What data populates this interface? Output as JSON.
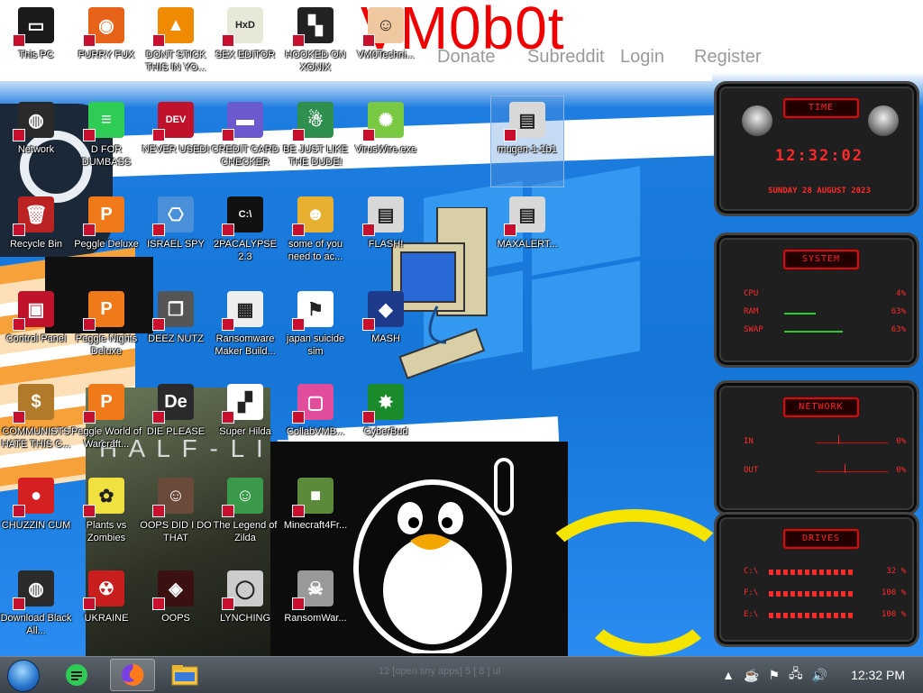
{
  "wallpaper": {
    "brand": "VM0b0t",
    "nav": [
      "Donate",
      "Subreddit",
      "Login",
      "Register"
    ]
  },
  "desktop_icons": [
    {
      "id": "this-pc",
      "label": "This PC",
      "icon": "computer-icon",
      "color": "#1a1a1a",
      "glyph": "▭"
    },
    {
      "id": "furry-fux",
      "label": "FURRY FUX",
      "icon": "firefox-icon",
      "color": "#e8631a",
      "glyph": "◉"
    },
    {
      "id": "dont-stick",
      "label": "DONT STICK THIS IN YO...",
      "icon": "vlc-cone-icon",
      "color": "#f08a00",
      "glyph": "▲"
    },
    {
      "id": "sex-editor",
      "label": "SEX EDITOR",
      "icon": "hxd-icon",
      "color": "#e8e8d8",
      "glyph": "HxD"
    },
    {
      "id": "hooked-on-xonix",
      "label": "HOOKED ON XONIX",
      "icon": "xonix-icon",
      "color": "#222222",
      "glyph": "▚"
    },
    {
      "id": "vm0technician",
      "label": "VM0Techni...",
      "icon": "doctor-icon",
      "color": "#f0c8a0",
      "glyph": "☺"
    },
    {
      "id": "network",
      "label": "Network",
      "icon": "alien-orb-icon",
      "color": "#2a2a2a",
      "glyph": "◍"
    },
    {
      "id": "d-for-dumbass",
      "label": "D FOR DUMBASS",
      "icon": "chat-bubble-icon",
      "color": "#2ecc55",
      "glyph": "≡"
    },
    {
      "id": "never-used",
      "label": "NEVER USED!",
      "icon": "devcpp-icon",
      "color": "#c0122a",
      "glyph": "DEV"
    },
    {
      "id": "credit-card-checker",
      "label": "CREDIT CARD CHECKER",
      "icon": "credit-card-icon",
      "color": "#6a5acd",
      "glyph": "▬"
    },
    {
      "id": "be-just-like",
      "label": "BE JUST LIKE THE DUDE!",
      "icon": "santa-icon",
      "color": "#2f8f4f",
      "glyph": "☃"
    },
    {
      "id": "viruswire",
      "label": "VirusWire.exe",
      "icon": "lime-icon",
      "color": "#7ac943",
      "glyph": "✺"
    },
    {
      "id": "mugen",
      "label": "mugen-1-1b1",
      "icon": "file-icon",
      "color": "#d8d8d8",
      "glyph": "▤"
    },
    {
      "id": "recycle-bin",
      "label": "Recycle Bin",
      "icon": "trash-bin-icon",
      "color": "#bb2222",
      "glyph": "🗑"
    },
    {
      "id": "peggle-deluxe",
      "label": "Peggle Deluxe",
      "icon": "peggle-icon",
      "color": "#f07a1a",
      "glyph": "P"
    },
    {
      "id": "israel-spy",
      "label": "ISRAEL SPY",
      "icon": "network-pc-icon",
      "color": "#4a90d9",
      "glyph": "⎔"
    },
    {
      "id": "2pacalypse",
      "label": "2PACALYPSE 2.3",
      "icon": "terminal-icon",
      "color": "#111111",
      "glyph": "C:\\"
    },
    {
      "id": "some-of-you",
      "label": "some of you need to ac...",
      "icon": "dog-icon",
      "color": "#e8b030",
      "glyph": "☻"
    },
    {
      "id": "flash",
      "label": "FLASH!",
      "icon": "file-icon",
      "color": "#d8d8d8",
      "glyph": "▤"
    },
    {
      "id": "maxalert",
      "label": "MAXALERT...",
      "icon": "file-icon",
      "color": "#d8d8d8",
      "glyph": "▤"
    },
    {
      "id": "control-panel",
      "label": "Control Panel",
      "icon": "control-panel-icon",
      "color": "#c0122a",
      "glyph": "▣"
    },
    {
      "id": "peggle-nights",
      "label": "Peggle Nights Deluxe",
      "icon": "peggle-icon",
      "color": "#f07a1a",
      "glyph": "P"
    },
    {
      "id": "deez-nutz",
      "label": "DEEZ NUTZ",
      "icon": "copy-window-icon",
      "color": "#555555",
      "glyph": "❐"
    },
    {
      "id": "ransomware-maker",
      "label": "Ransomware Maker Build...",
      "icon": "app-window-icon",
      "color": "#eeeeee",
      "glyph": "▦"
    },
    {
      "id": "japan-suicide",
      "label": "japan suicide sim",
      "icon": "japan-icon",
      "color": "#ffffff",
      "glyph": "⚑"
    },
    {
      "id": "mash",
      "label": "MASH",
      "icon": "spy-hat-icon",
      "color": "#1e3a8a",
      "glyph": "◆"
    },
    {
      "id": "communists",
      "label": "COMMUNISTS HATE THIS C...",
      "icon": "money-bag-icon",
      "color": "#b07a2a",
      "glyph": "$"
    },
    {
      "id": "peggle-world",
      "label": "Peggle World of Warcraft...",
      "icon": "peggle-icon",
      "color": "#f07a1a",
      "glyph": "P"
    },
    {
      "id": "die-please",
      "label": "DIE PLEASE",
      "icon": "de-icon",
      "color": "#2a2a2a",
      "glyph": "De"
    },
    {
      "id": "super-hilda",
      "label": "Super Hilda",
      "icon": "pixel-cat-icon",
      "color": "#ffffff",
      "glyph": "▞"
    },
    {
      "id": "collabvm",
      "label": "CollabVMB...",
      "icon": "pink-monitor-icon",
      "color": "#e04d9a",
      "glyph": "▢"
    },
    {
      "id": "cyberbud",
      "label": "CyberBud",
      "icon": "bug-icon",
      "color": "#1a8a2a",
      "glyph": "✸"
    },
    {
      "id": "chuzzin",
      "label": "CHUZZIN CUM",
      "icon": "chuzzle-icon",
      "color": "#d42020",
      "glyph": "●"
    },
    {
      "id": "plants-vs-zombies",
      "label": "Plants vs Zombies",
      "icon": "flower-icon",
      "color": "#f0e040",
      "glyph": "✿"
    },
    {
      "id": "oops-did-i",
      "label": "OOPS DID I DO THAT",
      "icon": "portrait-icon",
      "color": "#6a4a3a",
      "glyph": "☺"
    },
    {
      "id": "legend-of-zilda",
      "label": "The Legend of Zilda",
      "icon": "hero-sprite-icon",
      "color": "#3a9a4a",
      "glyph": "☺"
    },
    {
      "id": "minecraft4free",
      "label": "Minecraft4Fr...",
      "icon": "grass-block-icon",
      "color": "#5a8a3a",
      "glyph": "■"
    },
    {
      "id": "download-black",
      "label": "Download Black All...",
      "icon": "alien-orb-icon",
      "color": "#2a2a2a",
      "glyph": "◍"
    },
    {
      "id": "ukraine",
      "label": "UKRAINE",
      "icon": "radiation-icon",
      "color": "#c81e1e",
      "glyph": "☢"
    },
    {
      "id": "oops",
      "label": "OOPS",
      "icon": "dark-app-icon",
      "color": "#3a1010",
      "glyph": "◈"
    },
    {
      "id": "lynching",
      "label": "LYNCHING",
      "icon": "rope-icon",
      "color": "#cccccc",
      "glyph": "◯"
    },
    {
      "id": "ransomware",
      "label": "RansomWar...",
      "icon": "skull-ring-icon",
      "color": "#999999",
      "glyph": "☠"
    }
  ],
  "gadget": {
    "time_title": "TIME",
    "time": "12:32:02",
    "date": "SUNDAY 28 AUGUST 2023",
    "system_title": "SYSTEM",
    "system_rows": [
      {
        "key": "CPU",
        "value": "4%",
        "level": 0
      },
      {
        "key": "RAM",
        "value": "63%",
        "level": 0.63
      },
      {
        "key": "SWAP",
        "value": "63%",
        "level": 0.63
      }
    ],
    "network_title": "NETWORK",
    "network_rows": [
      {
        "key": "IN",
        "value": "0%"
      },
      {
        "key": "OUT",
        "value": "0%"
      }
    ],
    "drives_title": "DRIVES",
    "drive_rows": [
      {
        "key": "C:\\",
        "value": "32 %"
      },
      {
        "key": "F:\\",
        "value": "100 %"
      },
      {
        "key": "E:\\",
        "value": "100 %"
      }
    ]
  },
  "taskbar": {
    "faded_text": "12 [open tiny apps] 5 [ 8 ] ul",
    "clock": "12:32 PM",
    "tray": [
      {
        "name": "java-icon",
        "glyph": "☕"
      },
      {
        "name": "flag-icon",
        "glyph": "⚑"
      },
      {
        "name": "network-status-icon",
        "glyph": "🖧"
      },
      {
        "name": "volume-icon",
        "glyph": "🔊"
      }
    ]
  }
}
